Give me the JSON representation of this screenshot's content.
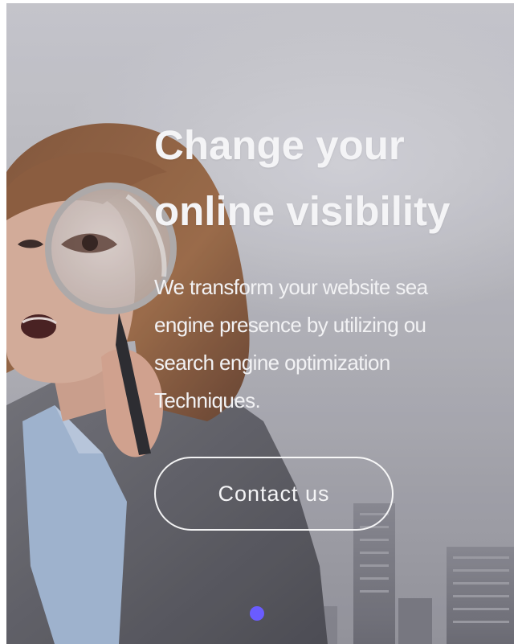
{
  "hero": {
    "headline": {
      "line1": "Change your",
      "line2": "online visibility"
    },
    "description": {
      "line1": "We transform your website sea",
      "line2": "engine presence by utilizing ou",
      "line3": "search engine optimization",
      "line4": "Techniques."
    },
    "cta_label": "Contact us",
    "background_image": "woman-with-magnifying-glass-city-skyline"
  },
  "carousel": {
    "active_dot_color": "#6a5cff",
    "active_index": 0
  },
  "colors": {
    "text": "#f4f4f6",
    "accent": "#6a5cff"
  }
}
